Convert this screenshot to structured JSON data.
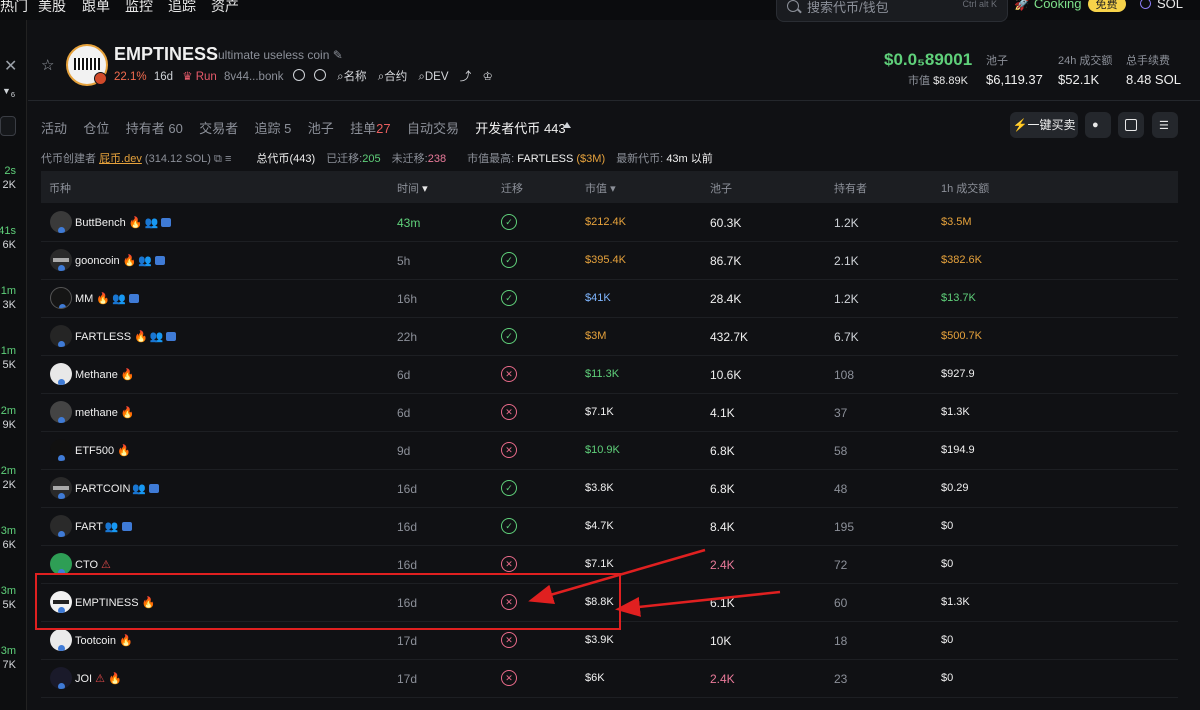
{
  "top_nav": {
    "items": [
      "热门",
      "美股",
      "跟单",
      "监控",
      "追踪",
      "资产"
    ],
    "search_placeholder": "搜索代币/钱包",
    "search_shortcut": "Ctrl alt K",
    "cooking_label": "Cooking",
    "free_badge": "免费",
    "chain": "SOL"
  },
  "sidebar": {
    "filter_count": "6",
    "items": [
      {
        "time": "2s",
        "value": "2K"
      },
      {
        "time": "41s",
        "value": "6K"
      },
      {
        "time": "1m",
        "value": "3K"
      },
      {
        "time": "1m",
        "value": "5K"
      },
      {
        "time": "2m",
        "value": "9K"
      },
      {
        "time": "2m",
        "value": "2K"
      },
      {
        "time": "3m",
        "value": "6K"
      },
      {
        "time": "3m",
        "value": "5K"
      },
      {
        "time": "3m",
        "value": "7K"
      }
    ]
  },
  "token": {
    "name": "EMPTINESS",
    "description": "ultimate useless coin",
    "change_pct": "22.1%",
    "age": "16d",
    "run_label": "Run",
    "address": "8v44...bonk",
    "link_name": "名称",
    "link_contract": "合约",
    "link_dev": "DEV",
    "price": "$0.0₅89001",
    "mcap_label": "市值",
    "mcap": "$8.89K",
    "pool_label": "池子",
    "pool": "$6,119.37",
    "vol_label": "24h 成交额",
    "vol": "$52.1K",
    "fee_label": "总手续费",
    "fee": "8.48 SOL"
  },
  "tabs": [
    {
      "label": "活动"
    },
    {
      "label": "仓位"
    },
    {
      "label": "持有者",
      "count": "60"
    },
    {
      "label": "交易者"
    },
    {
      "label": "追踪",
      "count": "5"
    },
    {
      "label": "池子"
    },
    {
      "label": "挂单",
      "count": "27"
    },
    {
      "label": "自动交易"
    },
    {
      "label": "开发者代币",
      "count": "443"
    }
  ],
  "toolbar": {
    "quick_buy": "一键买卖"
  },
  "info": {
    "creator_label": "代币创建者",
    "creator": "屁币.dev",
    "creator_sol": "(314.12 SOL)",
    "total_label": "总代币",
    "total": "(443)",
    "migrated_label": "已迁移:",
    "migrated": "205",
    "unmigrated_label": "未迁移:",
    "unmigrated": "238",
    "top_mcap_label": "市值最高:",
    "top_mcap_name": "FARTLESS",
    "top_mcap_val": "($3M)",
    "latest_label": "最新代币:",
    "latest_val": "43m 以前"
  },
  "table": {
    "headers": {
      "token": "币种",
      "time": "时间",
      "migrated": "迁移",
      "mcap": "市值",
      "pool": "池子",
      "holders": "持有者",
      "vol1h": "1h 成交额"
    },
    "rows": [
      {
        "name": "ButtBench",
        "time": "43m",
        "migrated": true,
        "mcap": "$212.4K",
        "pool": "60.3K",
        "holders": "1.2K",
        "vol": "$3.5M"
      },
      {
        "name": "gooncoin",
        "time": "5h",
        "migrated": true,
        "mcap": "$395.4K",
        "pool": "86.7K",
        "holders": "2.1K",
        "vol": "$382.6K"
      },
      {
        "name": "MM",
        "time": "16h",
        "migrated": true,
        "mcap": "$41K",
        "pool": "28.4K",
        "holders": "1.2K",
        "vol": "$13.7K"
      },
      {
        "name": "FARTLESS",
        "time": "22h",
        "migrated": true,
        "mcap": "$3M",
        "pool": "432.7K",
        "holders": "6.7K",
        "vol": "$500.7K"
      },
      {
        "name": "Methane",
        "time": "6d",
        "migrated": false,
        "mcap": "$11.3K",
        "pool": "10.6K",
        "holders": "108",
        "vol": "$927.9"
      },
      {
        "name": "methane",
        "time": "6d",
        "migrated": false,
        "mcap": "$7.1K",
        "pool": "4.1K",
        "holders": "37",
        "vol": "$1.3K"
      },
      {
        "name": "ETF500",
        "time": "9d",
        "migrated": false,
        "mcap": "$10.9K",
        "pool": "6.8K",
        "holders": "58",
        "vol": "$194.9"
      },
      {
        "name": "FARTCOIN",
        "time": "16d",
        "migrated": true,
        "mcap": "$3.8K",
        "pool": "6.8K",
        "holders": "48",
        "vol": "$0.29"
      },
      {
        "name": "FART",
        "time": "16d",
        "migrated": true,
        "mcap": "$4.7K",
        "pool": "8.4K",
        "holders": "195",
        "vol": "$0"
      },
      {
        "name": "CTO",
        "time": "16d",
        "migrated": false,
        "mcap": "$7.1K",
        "pool": "2.4K",
        "holders": "72",
        "vol": "$0"
      },
      {
        "name": "EMPTINESS",
        "time": "16d",
        "migrated": false,
        "mcap": "$8.8K",
        "pool": "6.1K",
        "holders": "60",
        "vol": "$1.3K"
      },
      {
        "name": "Tootcoin",
        "time": "17d",
        "migrated": false,
        "mcap": "$3.9K",
        "pool": "10K",
        "holders": "18",
        "vol": "$0"
      },
      {
        "name": "JOI",
        "time": "17d",
        "migrated": false,
        "mcap": "$6K",
        "pool": "2.4K",
        "holders": "23",
        "vol": "$0"
      }
    ]
  },
  "colors": {
    "accent_green": "#5fd07a",
    "accent_orange": "#e6a23c",
    "annotation_red": "#e02020"
  }
}
